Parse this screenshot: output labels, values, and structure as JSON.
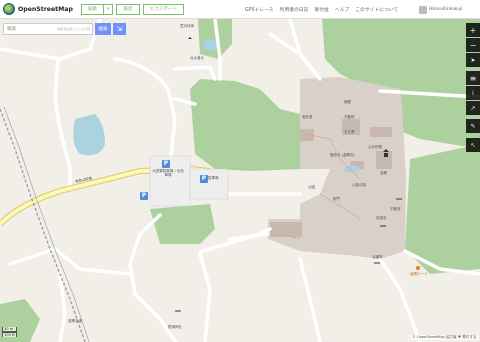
{
  "header": {
    "logo_text": "OpenStreetMap",
    "edit_label": "編集",
    "dropdown_symbol": "▾",
    "history_label": "履歴",
    "export_label": "エクスポート",
    "nav": [
      "GPSトレース",
      "利用者の日記",
      "寄付金",
      "ヘルプ",
      "このサイトについて"
    ],
    "user_name": "HikaruKinkakuji"
  },
  "search": {
    "placeholder": "検索",
    "hint": "場所名を使ってこの付近",
    "button_label": "検索",
    "directions_symbol": "⇲"
  },
  "map_labels": {
    "temple_top": "萱刈伴事",
    "north_gate": "北大道大",
    "bell": "鐘楼",
    "treasure": "宝形造",
    "hall1": "不動院",
    "hall2": "方丈庫",
    "shrine": "心字形殿",
    "kinkakuji": "鹿苑寺 (金閣寺)",
    "kinkaku_sub": "金閣",
    "road_main": "衣笠山町通",
    "parking1": "大型車駐車場 / 北西車場",
    "parking2": "駐車場",
    "station": "公園",
    "south_label": "公園の路",
    "gate1": "総門",
    "gate2": "不動堂",
    "gate3": "岩城寺",
    "south_shrine": "北福院",
    "far_south": "金閣寺道",
    "bottom_temple": "鏡湯神社",
    "orange_shop": "金閣ロード"
  },
  "controls": {
    "zoom_in": "+",
    "zoom_out": "−",
    "locate": "➤",
    "layers": "≡",
    "info": "i",
    "share": "↗",
    "note": "✎",
    "query": "↖"
  },
  "scale": {
    "top": "30 m",
    "bottom": "100 ft"
  },
  "attribution": "© OpenStreetMap 協力者 ♥ 寄付する",
  "colors": {
    "accent": "#7ebc6f",
    "button": "#7092ff",
    "land": "#f2efe9",
    "wood": "#add19e",
    "water": "#aad3df",
    "temple_area": "#d9d0c9"
  }
}
